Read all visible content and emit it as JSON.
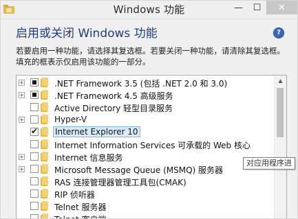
{
  "window": {
    "title": "Windows 功能",
    "minimize_glyph": "—",
    "maximize_glyph": "☐",
    "close_glyph": "✕"
  },
  "main": {
    "heading": "启用或关闭 Windows 功能",
    "help_glyph": "?",
    "description": "若要启用一种功能，请选择其复选框。若要关闭一种功能，请清除其复选框。填充的框表示仅启用该功能的一部分。"
  },
  "features": [
    {
      "label": ".NET Framework 3.5 (包括 .NET 2.0 和 3.0)",
      "expandable": true,
      "state": "partial",
      "selected": false
    },
    {
      "label": ".NET Framework 4.5 高级服务",
      "expandable": true,
      "state": "partial",
      "selected": false
    },
    {
      "label": "Active Directory 轻型目录服务",
      "expandable": false,
      "state": "unchecked",
      "selected": false
    },
    {
      "label": "Hyper-V",
      "expandable": true,
      "state": "unchecked",
      "selected": false
    },
    {
      "label": "Internet Explorer 10",
      "expandable": false,
      "state": "checked",
      "selected": true
    },
    {
      "label": "Internet Information Services 可承载的 Web 核心",
      "expandable": false,
      "state": "unchecked",
      "selected": false
    },
    {
      "label": "Internet 信息服务",
      "expandable": true,
      "state": "unchecked",
      "selected": false
    },
    {
      "label": "Microsoft Message Queue (MSMQ) 服务器",
      "expandable": true,
      "state": "unchecked",
      "selected": false
    },
    {
      "label": "RAS 连接管理器管理工具包(CMAK)",
      "expandable": false,
      "state": "unchecked",
      "selected": false
    },
    {
      "label": "RIP 侦听器",
      "expandable": false,
      "state": "unchecked",
      "selected": false
    },
    {
      "label": "Telnet 服务器",
      "expandable": false,
      "state": "unchecked",
      "selected": false
    },
    {
      "label": "Telnet 客户端",
      "expandable": false,
      "state": "unchecked",
      "selected": false
    }
  ],
  "tooltip": {
    "text": "对应用程序进"
  },
  "colors": {
    "heading": "#1f3c88",
    "selection_bg": "#d7ebfc",
    "selection_border": "#7fb4e8",
    "folder": "#e8b93c"
  }
}
